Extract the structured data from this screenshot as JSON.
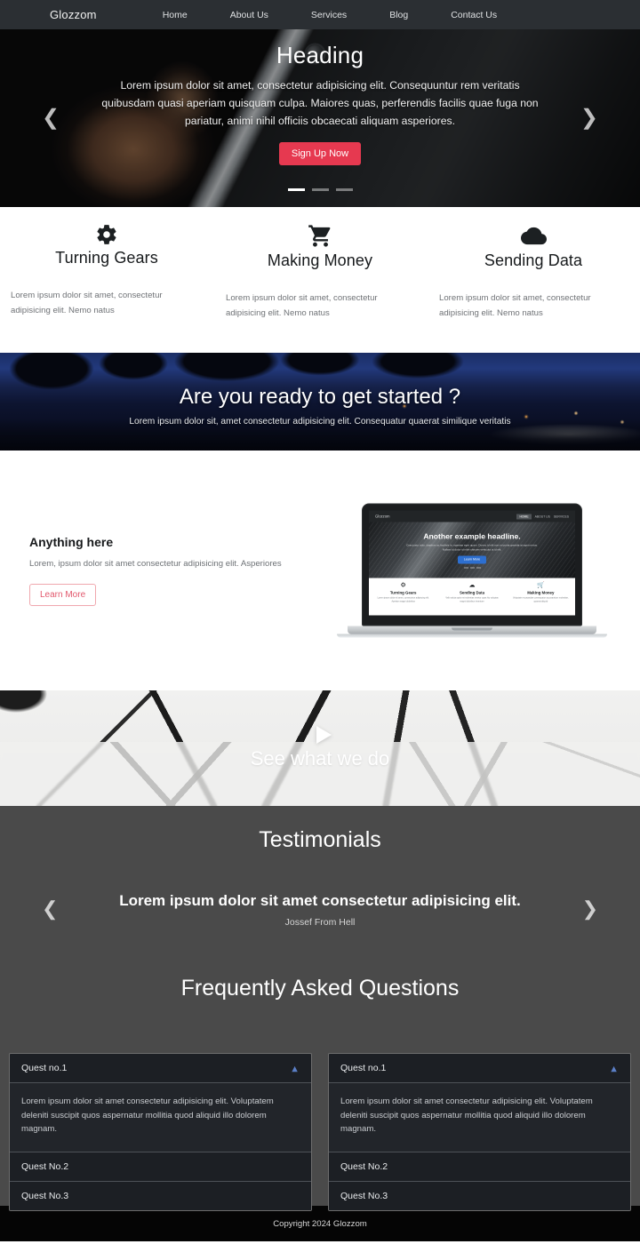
{
  "navbar": {
    "brand": "Glozzom",
    "links": [
      {
        "label": "Home"
      },
      {
        "label": "About Us"
      },
      {
        "label": "Services"
      },
      {
        "label": "Blog"
      },
      {
        "label": "Contact Us"
      }
    ]
  },
  "hero": {
    "title": "Heading",
    "subtitle": "Lorem ipsum dolor sit amet, consectetur adipisicing elit. Consequuntur rem veritatis quibusdam quasi aperiam quisquam culpa. Maiores quas, perferendis facilis quae fuga non pariatur, animi nihil officiis obcaecati aliquam asperiores.",
    "cta_label": "Sign Up Now",
    "prev_icon": "chevron-left-icon",
    "next_icon": "chevron-right-icon",
    "slide_count": 3,
    "active_slide": 1,
    "accent_color": "#e63950"
  },
  "features": [
    {
      "icon": "gear-icon",
      "title": "Turning Gears",
      "text": "Lorem ipsum dolor sit amet, consectetur adipisicing elit. Nemo natus"
    },
    {
      "icon": "shopping-cart-icon",
      "title": "Making Money",
      "text": "Lorem ipsum dolor sit amet, consectetur adipisicing elit. Nemo natus"
    },
    {
      "icon": "cloud-icon",
      "title": "Sending Data",
      "text": "Lorem ipsum dolor sit amet, consectetur adipisicing elit. Nemo natus"
    }
  ],
  "cta_band": {
    "title": "Are you ready to get started ?",
    "subtitle": "Lorem ipsum dolor sit, amet consectetur adipisicing elit. Consequatur quaerat similique veritatis"
  },
  "about": {
    "title": "Anything here",
    "text": "Lorem, ipsum dolor sit amet consectetur adipisicing elit. Asperiores",
    "button_label": "Learn More",
    "button_color": "#e2576c",
    "mockup": {
      "brand": "Glozzom",
      "nav": [
        {
          "label": "HOME",
          "active": true
        },
        {
          "label": "ABOUT US",
          "active": false
        },
        {
          "label": "SERVICES",
          "active": false
        }
      ],
      "headline": "Another example headline.",
      "paragraph": "Cras justo odio, dapibus ac facilisis in, egestas eget quam. Donec id elit non mi porta gravida at eget metus. Nullam id dolor id nibh ultricies vehicula ut id elit.",
      "button_label": "Learn More",
      "features": [
        {
          "icon": "gear-icon",
          "title": "Turning Gears",
          "text": "Lorem ipsum dolor sit amet, consectetur adipiscing elit. Aperiam magni doloribus"
        },
        {
          "icon": "cloud-icon",
          "title": "Sending Data",
          "text": "Velit soluta optio est molestias tenetur quas hic voluptas magni doloribus inventore"
        },
        {
          "icon": "shopping-cart-icon",
          "title": "Making Money",
          "text": "Voluptate recusandae consequatur accusantium molestiae, quaerat aliquid"
        }
      ]
    }
  },
  "video": {
    "title": "See what we do",
    "play_icon": "play-icon"
  },
  "testimonials": {
    "section_title": "Testimonials",
    "quote": "Lorem ipsum dolor sit amet consectetur adipisicing elit.",
    "author": "Jossef From Hell",
    "prev_icon": "chevron-left-icon",
    "next_icon": "chevron-right-icon"
  },
  "faq": {
    "section_title": "Frequently Asked Questions",
    "columns": [
      {
        "items": [
          {
            "question": "Quest no.1",
            "answer": "Lorem ipsum dolor sit amet consectetur adipisicing elit. Voluptatem deleniti suscipit quos aspernatur mollitia quod aliquid illo dolorem magnam.",
            "expanded": true,
            "chevron": "chevron-up-icon"
          },
          {
            "question": "Quest No.2",
            "expanded": false
          },
          {
            "question": "Quest No.3",
            "expanded": false
          }
        ]
      },
      {
        "items": [
          {
            "question": "Quest no.1",
            "answer": "Lorem ipsum dolor sit amet consectetur adipisicing elit. Voluptatem deleniti suscipit quos aspernatur mollitia quod aliquid illo dolorem magnam.",
            "expanded": true,
            "chevron": "chevron-up-icon"
          },
          {
            "question": "Quest No.2",
            "expanded": false
          },
          {
            "question": "Quest No.3",
            "expanded": false
          }
        ]
      }
    ]
  },
  "footer": {
    "copyright": "Copyright 2024 Glozzom"
  }
}
